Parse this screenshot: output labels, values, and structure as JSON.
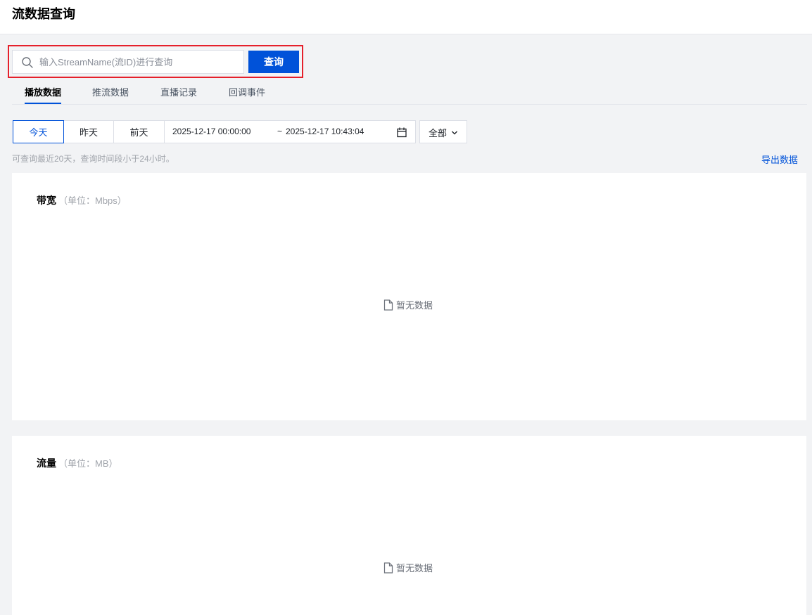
{
  "page": {
    "title": "流数据查询"
  },
  "search": {
    "placeholder": "输入StreamName(流ID)进行查询",
    "value": "",
    "button_label": "查询"
  },
  "tabs": [
    {
      "label": "播放数据",
      "active": true
    },
    {
      "label": "推流数据",
      "active": false
    },
    {
      "label": "直播记录",
      "active": false
    },
    {
      "label": "回调事件",
      "active": false
    }
  ],
  "filters": {
    "day_buttons": [
      {
        "label": "今天",
        "active": true
      },
      {
        "label": "昨天",
        "active": false
      },
      {
        "label": "前天",
        "active": false
      }
    ],
    "date_range": {
      "start": "2025-12-17 00:00:00",
      "separator": "~",
      "end": "2025-12-17 10:43:04"
    },
    "scope_select": {
      "selected": "全部"
    }
  },
  "hint": "可查询最近20天，查询时间段小于24小时。",
  "export_label": "导出数据",
  "cards": [
    {
      "title": "带宽",
      "unit": "（单位：Mbps）",
      "empty_text": "暂无数据"
    },
    {
      "title": "流量",
      "unit": "（单位：MB）",
      "empty_text": "暂无数据"
    }
  ],
  "colors": {
    "primary": "#0052d9",
    "highlight_border": "#e5202b",
    "page_background": "#f2f3f5",
    "muted_text": "#a0a4ab"
  },
  "icons": [
    "search-icon",
    "calendar-icon",
    "chevron-down-icon",
    "file-icon"
  ]
}
